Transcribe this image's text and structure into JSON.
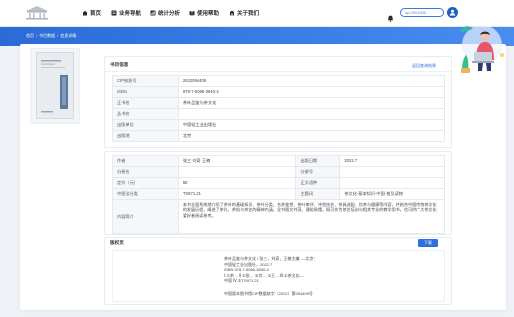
{
  "colors": {
    "primary": "#2f6fda",
    "background": "#eef1f6",
    "accent_pink": "#e8566b"
  },
  "header": {
    "nav": [
      {
        "label": "首页",
        "icon": "home-icon"
      },
      {
        "label": "业务导航",
        "icon": "list-icon"
      },
      {
        "label": "统计分析",
        "icon": "chart-icon"
      },
      {
        "label": "使用帮助",
        "icon": "book-icon"
      },
      {
        "label": "关于我们",
        "icon": "info-icon"
      }
    ],
    "notification_icon": "bell-icon",
    "search_value": "sp-0001000",
    "avatar_icon": "user-icon"
  },
  "breadcrumb": {
    "items": [
      "首页",
      "书目数据",
      "信息详情"
    ],
    "separator": "/"
  },
  "basic": {
    "title": "书目信息",
    "back_link": "返回查询结果",
    "rows": [
      {
        "label": "CIP核准号",
        "value": "2022094409"
      },
      {
        "label": "ISBN",
        "value": "978-7-5066-3840-4"
      },
      {
        "label": "正书名",
        "value": "茶叶品鉴与茶文化"
      },
      {
        "label": "丛书名",
        "value": ""
      },
      {
        "label": "出版单位",
        "value": "中国轻工业出版社"
      },
      {
        "label": "出版地",
        "value": "北京"
      }
    ]
  },
  "details": {
    "rows": [
      {
        "label": "作者",
        "value": "张三 刘奇 王楠",
        "label2": "出版日期",
        "value2": "2022.7"
      },
      {
        "label": "分册名",
        "value": "",
        "label2": "分册号",
        "value2": ""
      },
      {
        "label": "定价（元）",
        "value": "58",
        "label2": "正文语种",
        "value2": ""
      },
      {
        "label": "中图法分类",
        "value": "TS971.21",
        "label2": "主题词",
        "value2": "茶文化-基本知识-中国-普及读物"
      }
    ],
    "abstract_label": "内容简介",
    "abstract": "本书全面系统地介绍了茶叶的基础知识、茶叶分类、名茶鉴赏、茶叶审评、冲泡技艺、茶具选配、饮茶与健康等内容，并结合中国传统茶文化的发展历程，阐述了茶礼、茶俗与茶艺的精神内涵。全书图文并茂、通俗易懂，既可作为茶艺培训与相关专业的教学用书，也可供广大茶文化爱好者阅读参考。"
  },
  "copyright": {
    "title": "版权页",
    "button": "下载",
    "cip_lines": [
      "茶叶品鉴与茶文化 / 张三，刘奇，王楠主编. —北京：",
      "中国轻工业出版社，2022.7",
      "ISBN 978-7-5066-3840-4",
      "Ⅰ.①茶… Ⅱ.①张… ②刘… ③王… Ⅲ.①茶文化—",
      "中国 Ⅳ.①TS971.21"
    ],
    "cip_footer": "中国版本图书馆CIP数据核字（2022）第094409号"
  }
}
